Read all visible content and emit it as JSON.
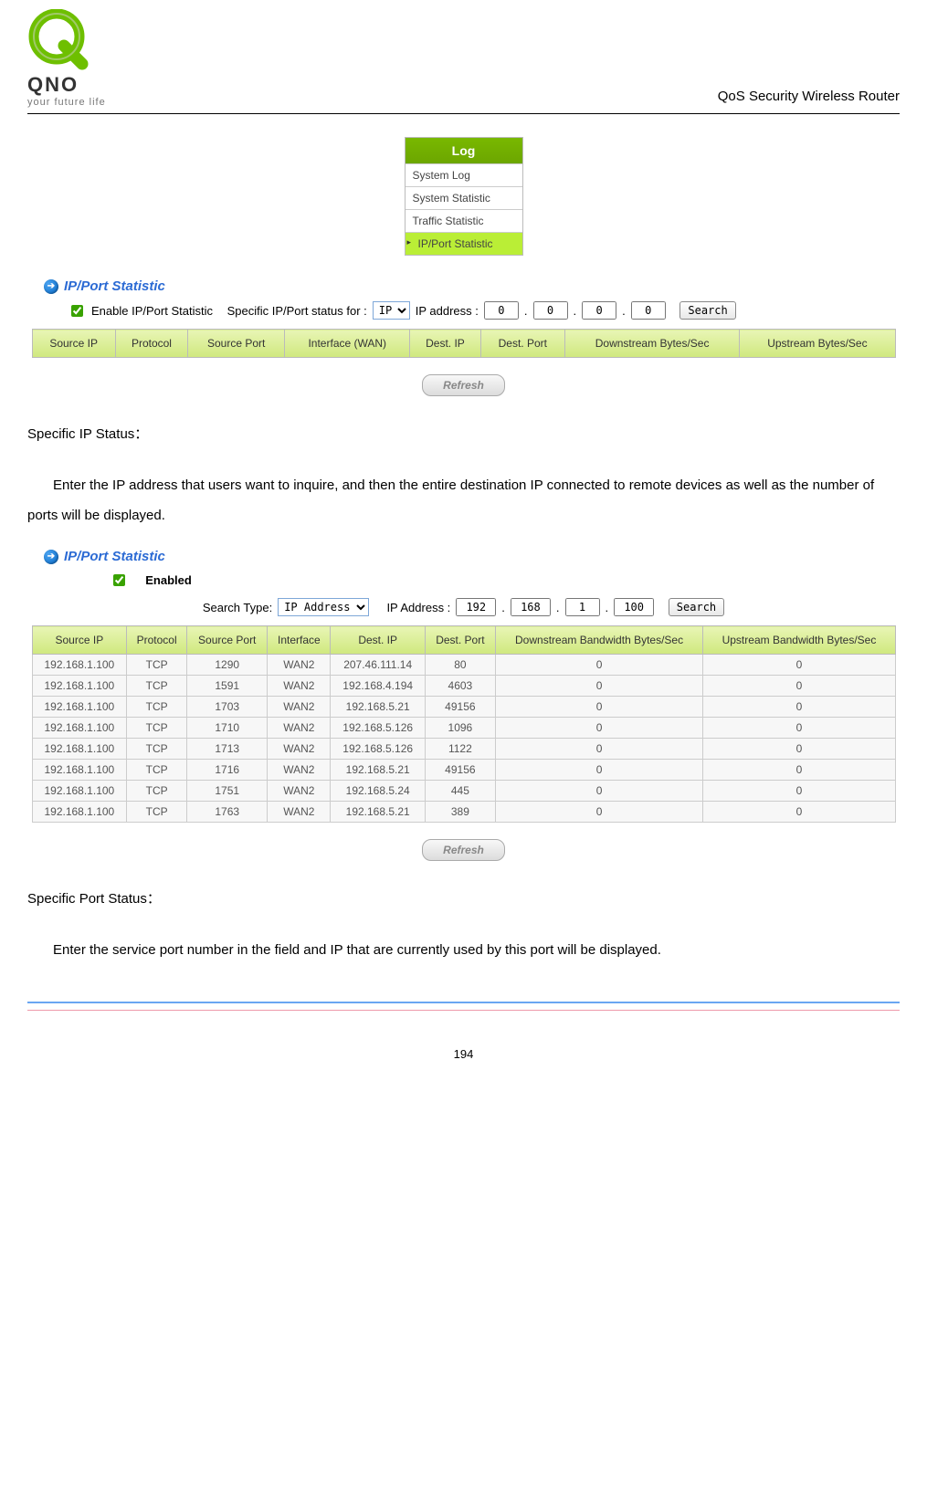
{
  "header": {
    "brand": "QNO",
    "tagline": "your future life",
    "title": "QoS Security Wireless Router"
  },
  "log_menu": {
    "title": "Log",
    "items": [
      "System Log",
      "System Statistic",
      "Traffic Statistic",
      "IP/Port Statistic"
    ],
    "selected_index": 3
  },
  "panel1": {
    "title": "IP/Port Statistic",
    "enable_label": "Enable IP/Port Statistic",
    "specific_label": "Specific IP/Port status for :",
    "type_value": "IP",
    "ip_label": "IP address :",
    "ip": [
      "0",
      "0",
      "0",
      "0"
    ],
    "search_label": "Search",
    "columns": [
      "Source IP",
      "Protocol",
      "Source Port",
      "Interface (WAN)",
      "Dest. IP",
      "Dest. Port",
      "Downstream Bytes/Sec",
      "Upstream Bytes/Sec"
    ],
    "refresh_label": "Refresh"
  },
  "text1": {
    "heading": "Specific IP Status：",
    "para": "Enter the IP address that users want to inquire, and then the entire destination IP connected to remote devices as well as the number of ports will be displayed."
  },
  "panel2": {
    "title": "IP/Port Statistic",
    "enabled_label": "Enabled",
    "search_type_label": "Search Type:",
    "search_type_value": "IP Address",
    "ip_label": "IP Address :",
    "ip": [
      "192",
      "168",
      "1",
      "100"
    ],
    "search_label": "Search",
    "columns": [
      "Source IP",
      "Protocol",
      "Source Port",
      "Interface",
      "Dest. IP",
      "Dest. Port",
      "Downstream Bandwidth Bytes/Sec",
      "Upstream Bandwidth Bytes/Sec"
    ],
    "rows": [
      [
        "192.168.1.100",
        "TCP",
        "1290",
        "WAN2",
        "207.46.111.14",
        "80",
        "0",
        "0"
      ],
      [
        "192.168.1.100",
        "TCP",
        "1591",
        "WAN2",
        "192.168.4.194",
        "4603",
        "0",
        "0"
      ],
      [
        "192.168.1.100",
        "TCP",
        "1703",
        "WAN2",
        "192.168.5.21",
        "49156",
        "0",
        "0"
      ],
      [
        "192.168.1.100",
        "TCP",
        "1710",
        "WAN2",
        "192.168.5.126",
        "1096",
        "0",
        "0"
      ],
      [
        "192.168.1.100",
        "TCP",
        "1713",
        "WAN2",
        "192.168.5.126",
        "1122",
        "0",
        "0"
      ],
      [
        "192.168.1.100",
        "TCP",
        "1716",
        "WAN2",
        "192.168.5.21",
        "49156",
        "0",
        "0"
      ],
      [
        "192.168.1.100",
        "TCP",
        "1751",
        "WAN2",
        "192.168.5.24",
        "445",
        "0",
        "0"
      ],
      [
        "192.168.1.100",
        "TCP",
        "1763",
        "WAN2",
        "192.168.5.21",
        "389",
        "0",
        "0"
      ]
    ],
    "refresh_label": "Refresh"
  },
  "text2": {
    "heading": "Specific Port Status：",
    "para": "Enter the service port number in the field and IP that are currently used by this port will be displayed."
  },
  "page_number": "194"
}
